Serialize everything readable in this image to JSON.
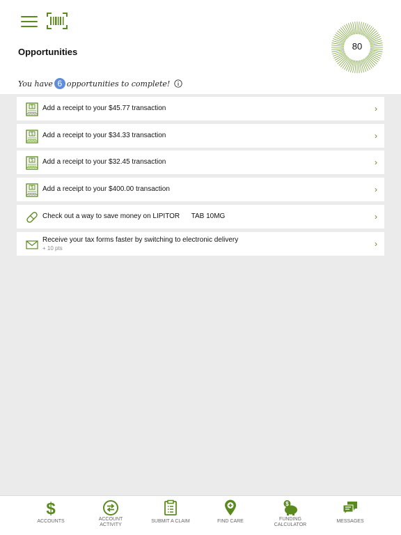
{
  "header": {
    "title": "Opportunities",
    "score": "80",
    "summary_before": "You have",
    "summary_count": "6",
    "summary_after": "opportunities to complete!"
  },
  "opportunities": [
    {
      "icon": "receipt-icon",
      "text": "Add a receipt to your $45.77 transaction"
    },
    {
      "icon": "receipt-icon",
      "text": "Add a receipt to your $34.33 transaction"
    },
    {
      "icon": "receipt-icon",
      "text": "Add a receipt to your $32.45 transaction"
    },
    {
      "icon": "receipt-icon",
      "text": "Add a receipt to your $400.00 transaction"
    },
    {
      "icon": "pill-icon",
      "text": "Check out a way to save money on LIPITOR      TAB 10MG"
    },
    {
      "icon": "envelope-icon",
      "text": "Receive your tax forms faster by switching to electronic delivery",
      "sub": "+ 10 pts"
    }
  ],
  "chevron": "›",
  "tabs": [
    {
      "label": "ACCOUNTS",
      "icon": "dollar-icon"
    },
    {
      "label": "ACCOUNT ACTIVITY",
      "icon": "transfer-icon"
    },
    {
      "label": "SUBMIT A CLAIM",
      "icon": "clipboard-icon"
    },
    {
      "label": "FIND CARE",
      "icon": "location-pin-icon"
    },
    {
      "label": "FUNDING CALCULATOR",
      "icon": "piggy-bank-icon"
    },
    {
      "label": "MESSAGES",
      "icon": "chat-bubbles-icon"
    }
  ],
  "colors": {
    "accent": "#5a8a1e",
    "badge": "#5f8ed6",
    "background": "#ebebeb"
  }
}
